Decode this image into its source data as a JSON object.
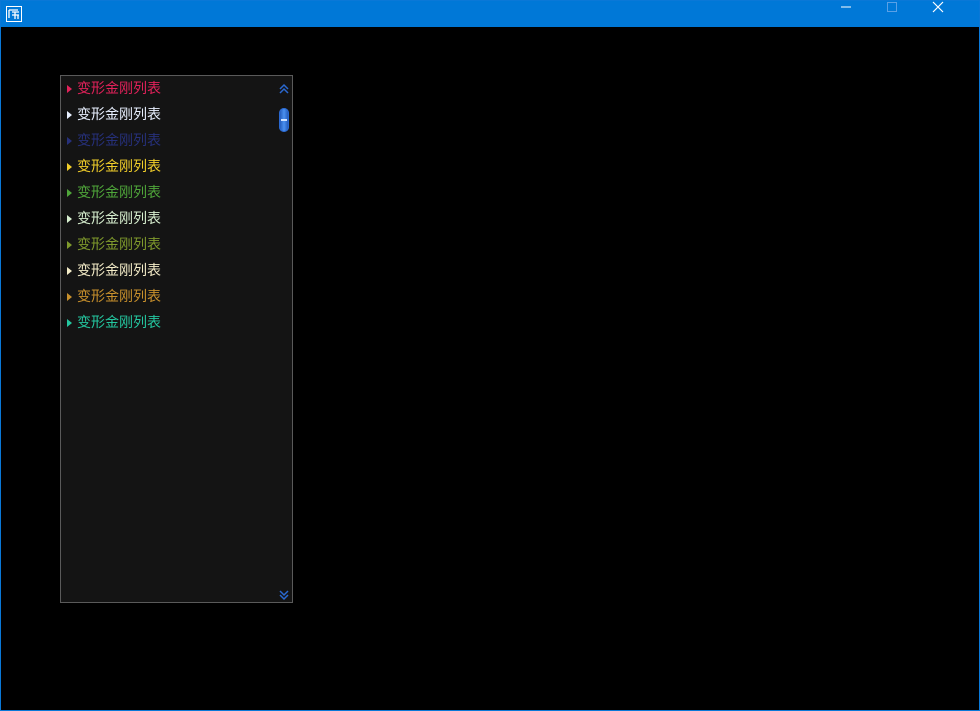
{
  "window": {
    "icon": "app-logo-icon",
    "controls": {
      "minimize_icon": "minimize-icon",
      "maximize_icon": "maximize-icon",
      "close_icon": "close-icon"
    }
  },
  "list": {
    "items": [
      {
        "label": "变形金刚列表",
        "color": "#e2215a"
      },
      {
        "label": "变形金刚列表",
        "color": "#e8f0ff"
      },
      {
        "label": "变形金刚列表",
        "color": "#26307a"
      },
      {
        "label": "变形金刚列表",
        "color": "#f2cf2a"
      },
      {
        "label": "变形金刚列表",
        "color": "#4fa63a"
      },
      {
        "label": "变形金刚列表",
        "color": "#d8f0d0"
      },
      {
        "label": "变形金刚列表",
        "color": "#7f9a2c"
      },
      {
        "label": "变形金刚列表",
        "color": "#f4ecc8"
      },
      {
        "label": "变形金刚列表",
        "color": "#c8902c"
      },
      {
        "label": "变形金刚列表",
        "color": "#24c7a0"
      }
    ],
    "scrollbar": {
      "up_icon": "double-chevron-up-icon",
      "down_icon": "double-chevron-down-icon",
      "accent": "#2a68d0"
    }
  }
}
